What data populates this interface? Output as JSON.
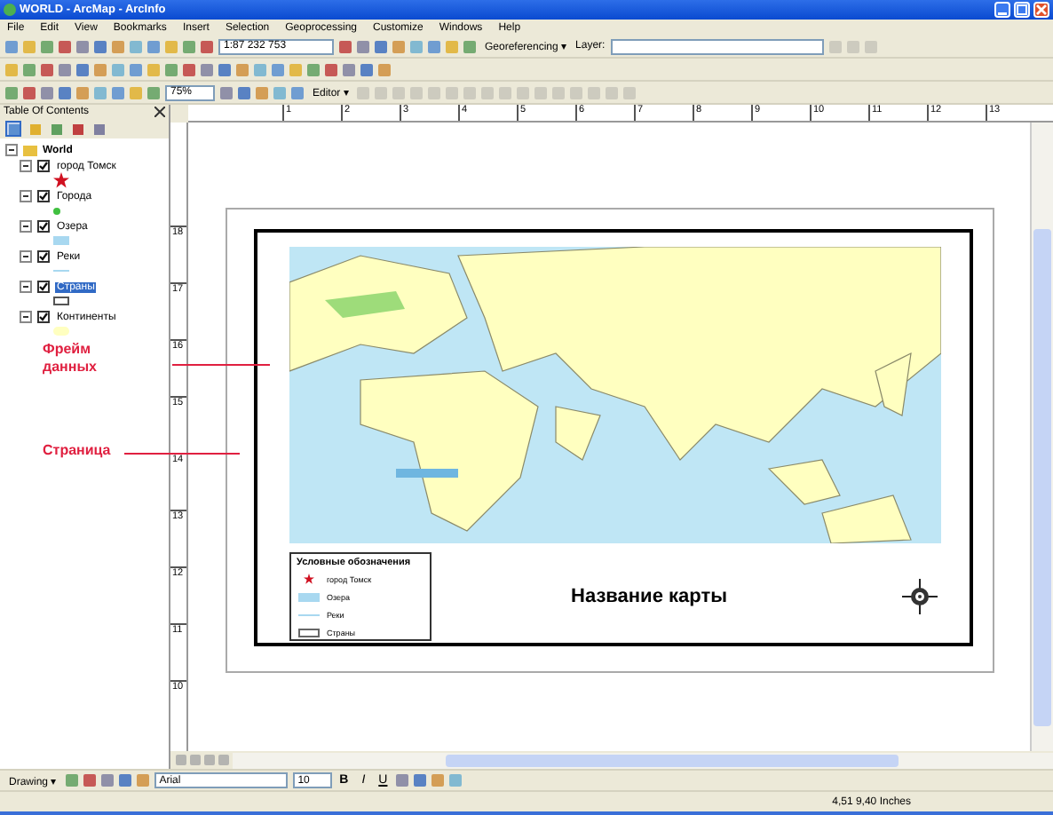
{
  "window": {
    "title": "WORLD - ArcMap - ArcInfo"
  },
  "menu": [
    "File",
    "Edit",
    "View",
    "Bookmarks",
    "Insert",
    "Selection",
    "Geoprocessing",
    "Customize",
    "Windows",
    "Help"
  ],
  "toolbars": {
    "scale": "1:87 232 753",
    "georeferencing": "Georeferencing ▾",
    "layer_label": "Layer:",
    "zoom": "75%",
    "editor": "Editor ▾"
  },
  "toc": {
    "title": "Table Of Contents",
    "tabs": [
      {
        "selected": true
      },
      {
        "selected": false
      },
      {
        "selected": false
      },
      {
        "selected": false
      },
      {
        "selected": false
      }
    ],
    "root": {
      "label": "World",
      "expanded": true,
      "children": [
        {
          "label": "город Томск",
          "checked": true,
          "expanded": true,
          "selected": false,
          "kind": "star",
          "color": "#d01020"
        },
        {
          "label": "Города",
          "checked": true,
          "expanded": true,
          "selected": false,
          "kind": "dot",
          "color": "#40c040"
        },
        {
          "label": "Озера",
          "checked": true,
          "expanded": true,
          "selected": false,
          "kind": "fill",
          "color": "#a8d8f0"
        },
        {
          "label": "Реки",
          "checked": true,
          "expanded": true,
          "selected": false,
          "kind": "line",
          "color": "#a8d8f0"
        },
        {
          "label": "Страны",
          "checked": true,
          "expanded": true,
          "selected": true,
          "kind": "outline"
        },
        {
          "label": "Континенты",
          "checked": true,
          "expanded": true,
          "selected": false,
          "kind": "blob",
          "color": "#ffffc0"
        }
      ]
    }
  },
  "rulers": {
    "horizontal": [
      "1",
      "2",
      "3",
      "4",
      "5",
      "6",
      "7",
      "8",
      "9",
      "10",
      "11",
      "12",
      "13"
    ],
    "vertical": [
      "18",
      "17",
      "16",
      "15",
      "14",
      "13",
      "12",
      "11",
      "10"
    ]
  },
  "annotations": [
    {
      "label": "Фрейм данных"
    },
    {
      "label": "Страница"
    }
  ],
  "layout": {
    "legend": {
      "title": "Условные обозначения",
      "items": [
        {
          "label": "город Томск",
          "kind": "star",
          "color": "#d01020"
        },
        {
          "label": "Озера",
          "kind": "fill",
          "color": "#a8d8f0"
        },
        {
          "label": "Реки",
          "kind": "line",
          "color": "#a8d8f0"
        },
        {
          "label": "Страны",
          "kind": "outline"
        }
      ]
    },
    "map_title": "Название карты"
  },
  "drawing_toolbar": {
    "menu": "Drawing ▾",
    "font": "Arial",
    "size": "10",
    "bold": "B",
    "italic": "I",
    "underline": "U"
  },
  "status_bar": {
    "coordinates": "4,51  9,40 Inches"
  }
}
